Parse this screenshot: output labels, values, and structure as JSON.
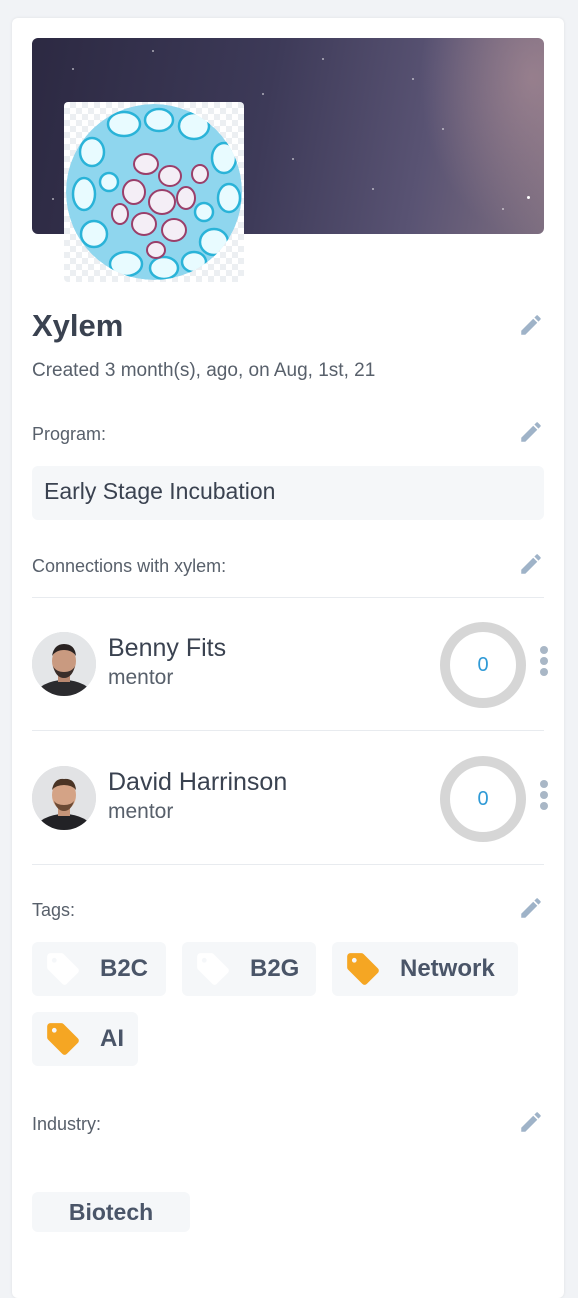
{
  "project": {
    "name": "Xylem",
    "created": "Created 3 month(s), ago, on Aug, 1st, 21"
  },
  "program": {
    "label": "Program:",
    "value": "Early Stage Incubation"
  },
  "connections": {
    "label": "Connections with xylem:",
    "items": [
      {
        "name": "Benny Fits",
        "role": "mentor",
        "count": "0"
      },
      {
        "name": "David Harrinson",
        "role": "mentor",
        "count": "0"
      }
    ]
  },
  "tags": {
    "label": "Tags:",
    "items": [
      {
        "name": "B2C",
        "active": false
      },
      {
        "name": "B2G",
        "active": false
      },
      {
        "name": "Network",
        "active": true
      },
      {
        "name": "AI",
        "active": true
      }
    ]
  },
  "industry": {
    "label": "Industry:",
    "items": [
      "Biotech"
    ]
  },
  "colors": {
    "accent": "#2f9ad6",
    "tag_active": "#f5a623",
    "tag_inactive": "#ffffff",
    "pencil": "#9fb3c8"
  },
  "icons": {
    "edit": "pencil-icon",
    "more": "kebab-menu-icon",
    "tag": "tag-icon"
  }
}
